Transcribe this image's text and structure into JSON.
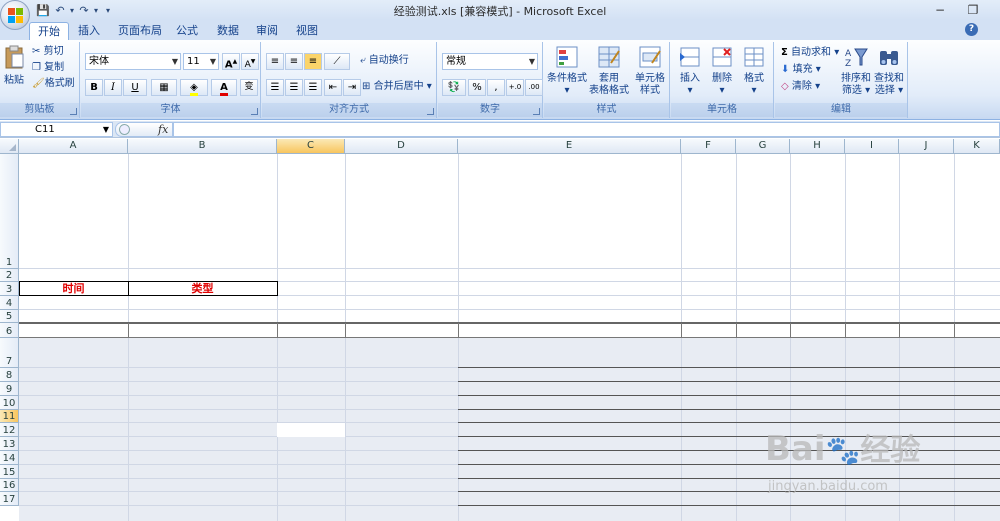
{
  "window": {
    "title": "经验测试.xls  [兼容模式] - Microsoft Excel",
    "minimize": "−",
    "restore": "❐"
  },
  "qat": {
    "save": "💾",
    "undo": "↶",
    "undo_arrow": "▾",
    "redo": "↷",
    "redo_arrow": "▾",
    "customize": "▾"
  },
  "tabs": [
    "开始",
    "插入",
    "页面布局",
    "公式",
    "数据",
    "审阅",
    "视图"
  ],
  "help": "?",
  "ribbon": {
    "clipboard": {
      "label": "剪贴板",
      "paste": "粘贴",
      "cut": "剪切",
      "copy": "复制",
      "format_painter": "格式刷"
    },
    "font": {
      "label": "字体",
      "font_name": "宋体",
      "font_size": "11",
      "bold": "B",
      "italic": "I",
      "underline": "U",
      "grow": "A",
      "shrink": "A",
      "font_color": "A",
      "phonetic": "变"
    },
    "alignment": {
      "label": "对齐方式",
      "wrap": "自动换行",
      "merge": "合并后居中"
    },
    "number": {
      "label": "数字",
      "format": "常规",
      "percent": "%",
      "comma": ",",
      "inc": "+.0",
      "dec": ".00"
    },
    "styles": {
      "label": "样式",
      "conditional": "条件格式",
      "table_format": "套用",
      "table_format2": "表格格式",
      "cell_styles": "单元格",
      "cell_styles2": "样式"
    },
    "cells": {
      "label": "单元格",
      "insert": "插入",
      "delete": "删除",
      "format": "格式"
    },
    "editing": {
      "label": "编辑",
      "autosum": "自动求和",
      "fill": "填充",
      "clear": "清除",
      "sort": "排序和",
      "sort2": "筛选",
      "find": "查找和",
      "find2": "选择",
      "sigma": "Σ"
    }
  },
  "formula_bar": {
    "name_box": "C11",
    "fx": "fx"
  },
  "columns": [
    "A",
    "B",
    "C",
    "D",
    "E",
    "F",
    "G",
    "H",
    "I",
    "J",
    "K"
  ],
  "rows": [
    "1",
    "2",
    "3",
    "4",
    "5",
    "6",
    "7",
    "8",
    "9",
    "10",
    "11",
    "12",
    "13",
    "14",
    "15",
    "16",
    "17"
  ],
  "cells": {
    "A3": "时间",
    "B3": "类型"
  },
  "watermark": {
    "brand": "Bai",
    "brand2": "经验",
    "url": "jingyan.baidu.com"
  },
  "colors": {
    "accent_text": "#e00000",
    "ribbon_text": "#15428b",
    "selected_header": "#f8c55e"
  }
}
